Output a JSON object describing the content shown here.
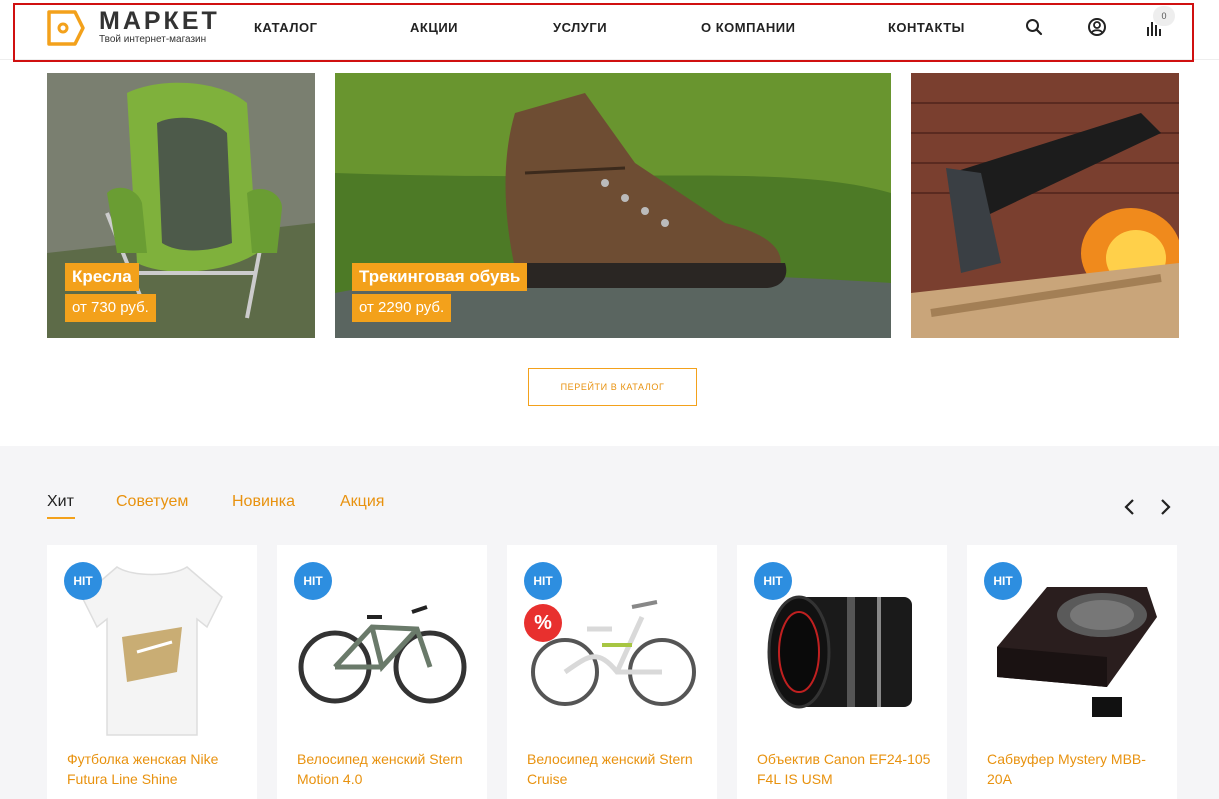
{
  "header": {
    "logo_title": "МАРКЕТ",
    "logo_subtitle": "Твой интернет-магазин",
    "nav": [
      "КАТАЛОГ",
      "АКЦИИ",
      "УСЛУГИ",
      "О КОМПАНИИ",
      "КОНТАКТЫ"
    ],
    "icons": [
      "search-icon",
      "user-icon",
      "compare-icon"
    ],
    "compare_count": "0"
  },
  "banners": [
    {
      "title": "Кресла",
      "price": "от 730 руб."
    },
    {
      "title": "Трекинговая обувь",
      "price": "от 2290 руб."
    },
    {
      "title": "",
      "price": ""
    }
  ],
  "catalog_button": "ПЕРЕЙТИ В КАТАЛОГ",
  "tabs": [
    "Хит",
    "Советуем",
    "Новинка",
    "Акция"
  ],
  "products": [
    {
      "name": "Футболка женская Nike Futura Line Shine",
      "badge": "HIT",
      "sale": ""
    },
    {
      "name": "Велосипед женский Stern Motion 4.0",
      "badge": "HIT",
      "sale": ""
    },
    {
      "name": "Велосипед женский Stern Cruise",
      "badge": "HIT",
      "sale": "%"
    },
    {
      "name": "Объектив Canon EF24-105 F4L IS USM",
      "badge": "HIT",
      "sale": ""
    },
    {
      "name": "Сабвуфер Mystery MBB-20A",
      "badge": "HIT",
      "sale": ""
    }
  ],
  "colors": {
    "accent": "#f3a11b",
    "link": "#e8920f",
    "hit": "#2d8ee0",
    "sale": "#e8302e",
    "highlight": "#d01010"
  }
}
